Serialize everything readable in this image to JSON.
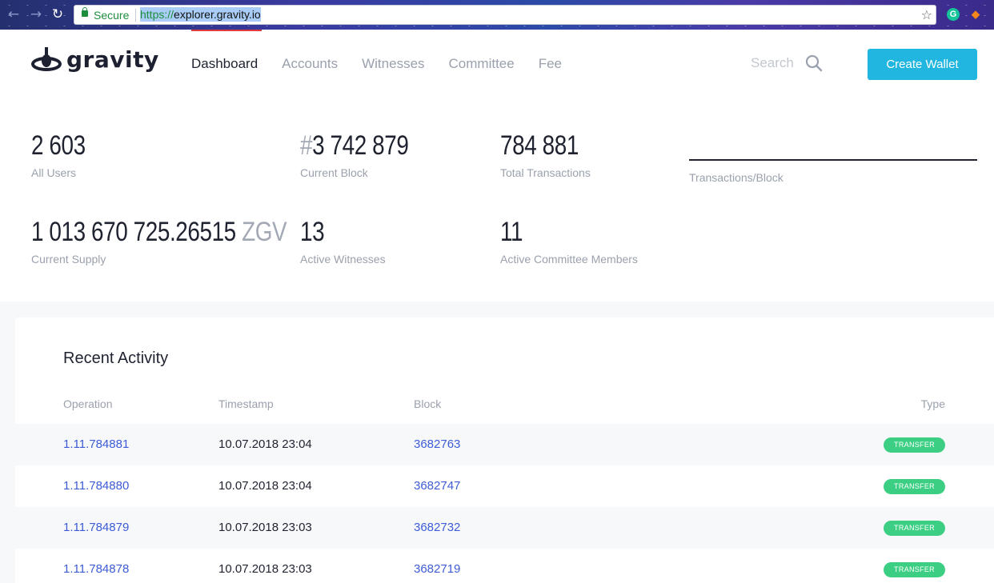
{
  "browser": {
    "secure_label": "Secure",
    "url_protocol": "https://",
    "url_host": "explorer.gravity.io"
  },
  "brand": {
    "name": "gravity"
  },
  "nav": {
    "items": [
      {
        "label": "Dashboard",
        "active": true
      },
      {
        "label": "Accounts",
        "active": false
      },
      {
        "label": "Witnesses",
        "active": false
      },
      {
        "label": "Committee",
        "active": false
      },
      {
        "label": "Fee",
        "active": false
      }
    ]
  },
  "search": {
    "placeholder": "Search"
  },
  "actions": {
    "create_wallet": "Create Wallet"
  },
  "stats": {
    "all_users": {
      "value": "2 603",
      "label": "All Users"
    },
    "current_block": {
      "prefix": "#",
      "value": "3 742 879",
      "label": "Current Block"
    },
    "total_transactions": {
      "value": "784 881",
      "label": "Total Transactions"
    },
    "transactions_per_block": {
      "label": "Transactions/Block"
    },
    "current_supply": {
      "value": "1 013 670 725.26515",
      "unit": "ZGV",
      "label": "Current Supply"
    },
    "active_witnesses": {
      "value": "13",
      "label": "Active Witnesses"
    },
    "active_committee": {
      "value": "11",
      "label": "Active Committee Members"
    }
  },
  "activity": {
    "title": "Recent Activity",
    "columns": {
      "operation": "Operation",
      "timestamp": "Timestamp",
      "block": "Block",
      "type": "Type"
    },
    "rows": [
      {
        "operation": "1.11.784881",
        "timestamp": "10.07.2018 23:04",
        "block": "3682763",
        "type": "TRANSFER"
      },
      {
        "operation": "1.11.784880",
        "timestamp": "10.07.2018 23:04",
        "block": "3682747",
        "type": "TRANSFER"
      },
      {
        "operation": "1.11.784879",
        "timestamp": "10.07.2018 23:03",
        "block": "3682732",
        "type": "TRANSFER"
      },
      {
        "operation": "1.11.784878",
        "timestamp": "10.07.2018 23:03",
        "block": "3682719",
        "type": "TRANSFER"
      }
    ]
  },
  "colors": {
    "accent": "#21b6e0",
    "active_marker": "#e23b3b",
    "link": "#3d5bd6",
    "badge": "#3ccf84"
  }
}
